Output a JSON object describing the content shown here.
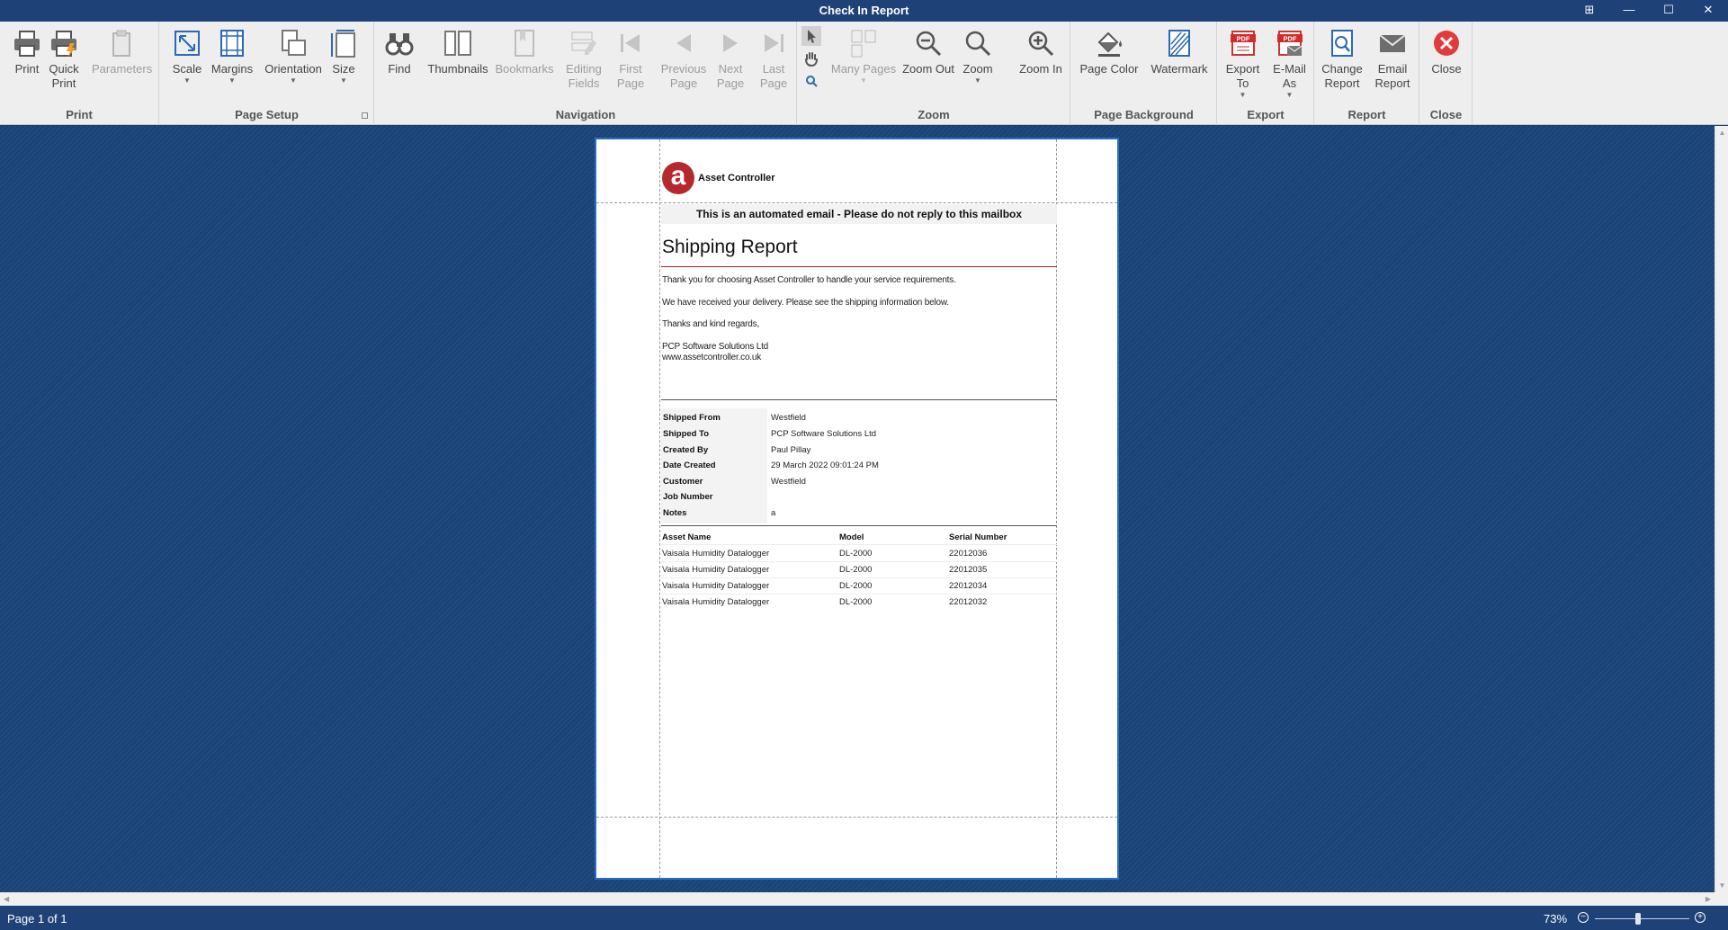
{
  "window": {
    "title": "Check In Report"
  },
  "ribbon": {
    "groups": {
      "print": "Print",
      "page_setup": "Page Setup",
      "navigation": "Navigation",
      "zoom": "Zoom",
      "page_background": "Page Background",
      "export": "Export",
      "report": "Report",
      "close": "Close"
    },
    "buttons": {
      "print": "Print",
      "quick_print": "Quick\nPrint",
      "parameters": "Parameters",
      "scale": "Scale",
      "margins": "Margins",
      "orientation": "Orientation",
      "size": "Size",
      "find": "Find",
      "thumbnails": "Thumbnails",
      "bookmarks": "Bookmarks",
      "editing_fields": "Editing\nFields",
      "first_page": "First\nPage",
      "previous_page": "Previous\nPage",
      "next_page": "Next\nPage",
      "last_page": "Last\nPage",
      "many_pages": "Many Pages",
      "zoom_out": "Zoom Out",
      "zoom": "Zoom",
      "zoom_in": "Zoom In",
      "page_color": "Page Color",
      "watermark": "Watermark",
      "export_to": "Export\nTo",
      "email_as": "E-Mail\nAs",
      "change_report": "Change\nReport",
      "email_report": "Email\nReport",
      "close": "Close"
    },
    "pdf_badge": "PDF"
  },
  "report": {
    "logo_letter": "a",
    "logo_text": "Asset Controller",
    "notice": "This is an automated email - Please do not reply to this mailbox",
    "title": "Shipping Report",
    "paragraphs": {
      "p1": "Thank you for choosing Asset Controller to handle your service requirements.",
      "p2": "We have received your delivery. Please see the shipping information below.",
      "p3": "Thanks and kind regards,",
      "p4": "PCP Software Solutions Ltd",
      "p5": "www.assetcontroller.co.uk"
    },
    "info": [
      {
        "label": "Shipped From",
        "value": "Westfield"
      },
      {
        "label": "Shipped To",
        "value": "PCP Software Solutions Ltd"
      },
      {
        "label": "Created By",
        "value": "Paul Pillay"
      },
      {
        "label": "Date Created",
        "value": "29 March 2022 09:01:24 PM"
      },
      {
        "label": "Customer",
        "value": "Westfield"
      },
      {
        "label": "Job Number",
        "value": ""
      },
      {
        "label": "Notes",
        "value": "a"
      }
    ],
    "table": {
      "headers": [
        "Asset Name",
        "Model",
        "Serial Number"
      ],
      "rows": [
        [
          "Vaisala Humidity Datalogger",
          "DL-2000",
          "22012036"
        ],
        [
          "Vaisala Humidity Datalogger",
          "DL-2000",
          "22012035"
        ],
        [
          "Vaisala Humidity Datalogger",
          "DL-2000",
          "22012034"
        ],
        [
          "Vaisala Humidity Datalogger",
          "DL-2000",
          "22012032"
        ]
      ]
    }
  },
  "status": {
    "page_info": "Page 1 of 1",
    "zoom": "73%",
    "zoom_fraction": 0.46
  }
}
